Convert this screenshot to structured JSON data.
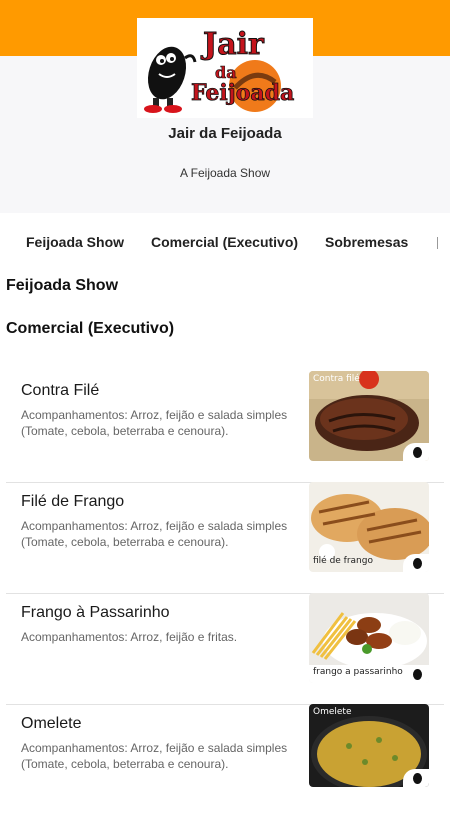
{
  "store": {
    "logo_text_line1": "Jair",
    "logo_text_line2": "da",
    "logo_text_line3": "Feijoada",
    "name": "Jair da Feijoada",
    "subtitle": "A Feijoada Show",
    "brand_color": "#ff9a00"
  },
  "tabs": [
    {
      "label": "Feijoada Show"
    },
    {
      "label": "Comercial (Executivo)"
    },
    {
      "label": "Sobremesas"
    }
  ],
  "sections": [
    {
      "title": "Feijoada Show"
    },
    {
      "title": "Comercial (Executivo)"
    }
  ],
  "items": [
    {
      "name": "Contra Filé",
      "description": "Acompanhamentos: Arroz, feijão e salada simples (Tomate, cebola, beterraba e cenoura).",
      "photo_caption": "Contra filé"
    },
    {
      "name": "Filé de Frango",
      "description": "Acompanhamentos: Arroz, feijão e salada simples (Tomate, cebola, beterraba e cenoura).",
      "photo_caption": "filé de frango"
    },
    {
      "name": "Frango à Passarinho",
      "description": "Acompanhamentos: Arroz, feijão e fritas.",
      "photo_caption": "frango a passarinho"
    },
    {
      "name": "Omelete",
      "description": "Acompanhamentos: Arroz, feijão e salada simples (Tomate, cebola, beterraba e cenoura).",
      "photo_caption": "Omelete"
    }
  ]
}
